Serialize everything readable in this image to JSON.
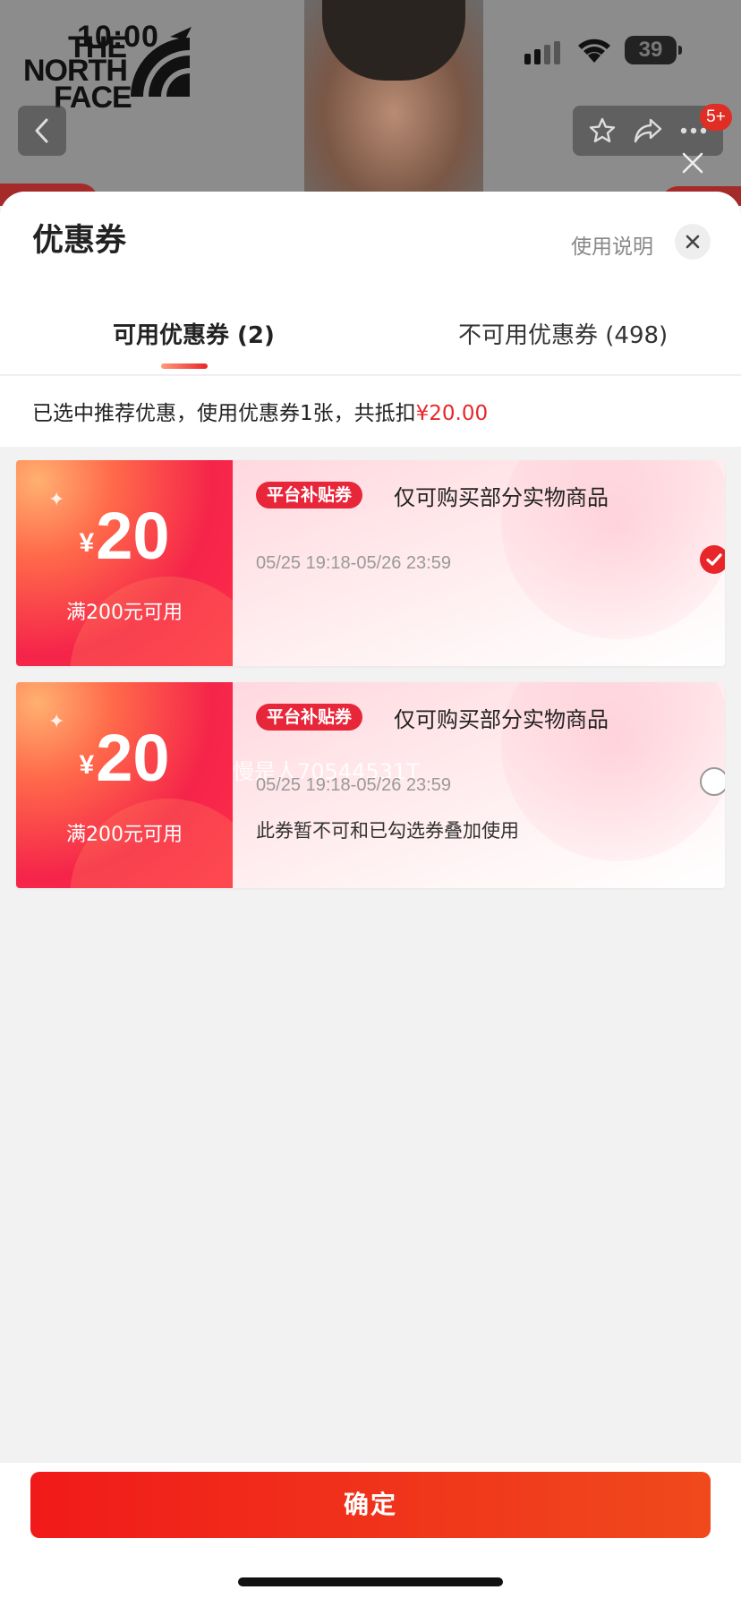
{
  "status_bar": {
    "time": "10:00",
    "battery": "39"
  },
  "background_page": {
    "brand_logo_text": "THE NORTH FACE",
    "cart_badge": "5+"
  },
  "sheet": {
    "title": "优惠券",
    "help_link": "使用说明",
    "tabs": [
      {
        "label": "可用优惠券 (2)",
        "selected": true
      },
      {
        "label": "不可用优惠券 (498)",
        "selected": false
      }
    ],
    "summary": {
      "text": "已选中推荐优惠，使用优惠券1张，共抵扣",
      "amount": "¥20.00"
    },
    "coupons": [
      {
        "currency": "¥",
        "amount": "20",
        "threshold": "满200元可用",
        "tag": "平台补贴券",
        "description": "仅可购买部分实物商品",
        "validity": "05/25 19:18-05/26 23:59",
        "note": "",
        "selected": true
      },
      {
        "currency": "¥",
        "amount": "20",
        "threshold": "满200元可用",
        "tag": "平台补贴券",
        "description": "仅可购买部分实物商品",
        "validity": "05/25 19:18-05/26 23:59",
        "note": "此券暂不可和已勾选券叠加使用",
        "watermark": "慢是人70544531T",
        "selected": false
      }
    ],
    "confirm_label": "确定"
  },
  "colors": {
    "accent": "#e8262a",
    "confirm_gradient_start": "#f11a1a",
    "confirm_gradient_end": "#f04a1c"
  },
  "icons": {
    "back": "chevron-left-icon",
    "favorite": "star-icon",
    "share": "share-icon",
    "more": "more-icon",
    "close": "close-icon",
    "checked": "check-circle-icon"
  }
}
